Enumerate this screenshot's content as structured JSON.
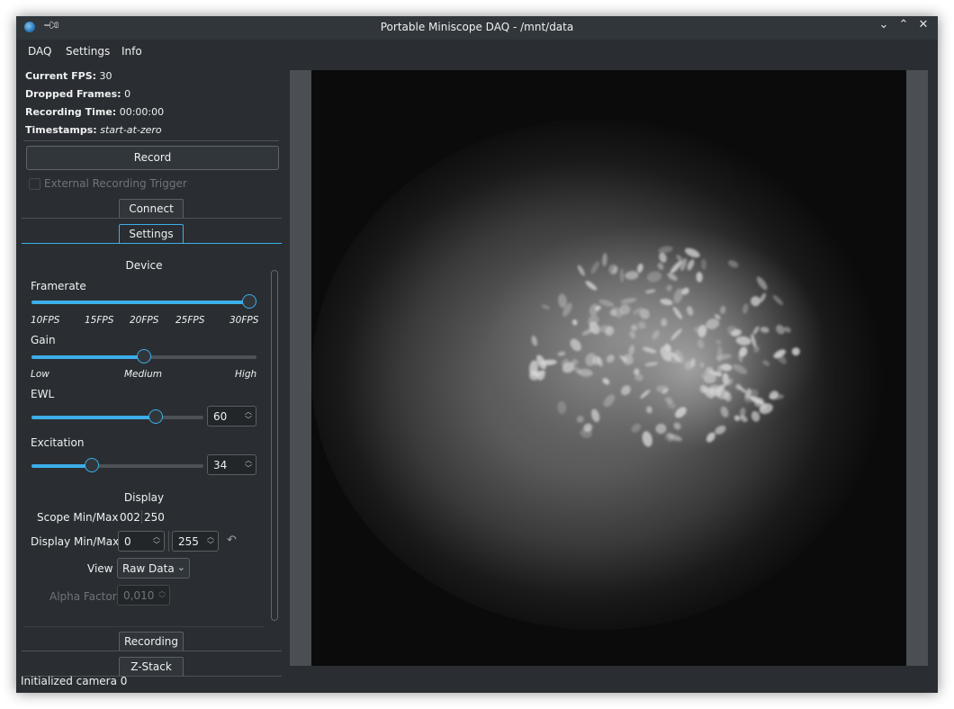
{
  "window": {
    "title": "Portable Miniscope DAQ - /mnt/data",
    "controls": [
      "⌄",
      "⌃",
      "✕"
    ],
    "icons": {
      "app": "miniscope-app-icon",
      "pin": "pin-icon"
    }
  },
  "menu": [
    "DAQ",
    "Settings",
    "Info"
  ],
  "info": {
    "fps_label": "Current FPS:",
    "fps_value": "30",
    "dropped_label": "Dropped Frames:",
    "dropped_value": "0",
    "rec_time_label": "Recording Time:",
    "rec_time_value": "00:00:00",
    "timestamps_label": "Timestamps:",
    "timestamps_value": "start-at-zero"
  },
  "record_button": "Record",
  "external_trigger": {
    "label": "External Recording Trigger",
    "checked": false,
    "enabled": false
  },
  "tabs": {
    "connect": "Connect",
    "settings": "Settings",
    "recording": "Recording",
    "zstack": "Z-Stack",
    "active": "Settings"
  },
  "device": {
    "title": "Device",
    "framerate": {
      "label": "Framerate",
      "ticks": [
        "10FPS",
        "15FPS",
        "20FPS",
        "25FPS",
        "30FPS"
      ],
      "value": "30FPS",
      "fraction": 1.0
    },
    "gain": {
      "label": "Gain",
      "ticks": [
        "Low",
        "Medium",
        "High"
      ],
      "value": "Medium",
      "fraction": 0.5
    },
    "ewl": {
      "label": "EWL",
      "value": "60",
      "fraction": 0.72
    },
    "excitation": {
      "label": "Excitation",
      "value": "34",
      "fraction": 0.35
    }
  },
  "display": {
    "title": "Display",
    "scope_minmax_label": "Scope Min/Max",
    "scope_min": "002",
    "scope_max": "250",
    "display_minmax_label": "Display Min/Max",
    "display_min": "0",
    "display_max": "255",
    "view_label": "View",
    "view_value": "Raw Data",
    "alpha_label": "Alpha Factor",
    "alpha_value": "0,010"
  },
  "status": "Initialized camera 0",
  "colors": {
    "accent": "#3daee9",
    "background": "#2a2e32",
    "panel": "#31363b",
    "text": "#eff0f1"
  }
}
